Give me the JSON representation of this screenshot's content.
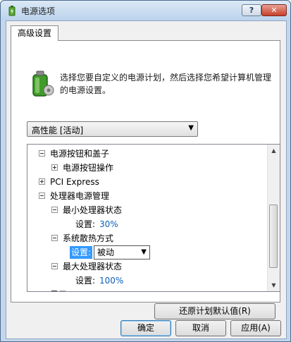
{
  "window": {
    "title": "电源选项",
    "help_label": "?",
    "close_label": "✕"
  },
  "tab": {
    "label": "高级设置"
  },
  "description": "选择您要自定义的电源计划，然后选择您希望计算机管理的电源设置。",
  "plan": {
    "selected": "高性能 [活动]"
  },
  "tree": {
    "items": [
      {
        "label": "电源按钮和盖子"
      },
      {
        "label": "电源按钮操作"
      },
      {
        "label": "PCI Express"
      },
      {
        "label": "处理器电源管理"
      },
      {
        "label": "最小处理器状态"
      },
      {
        "label": "设置:",
        "value": "30%"
      },
      {
        "label": "系统散热方式"
      },
      {
        "label": "设置:",
        "value": "被动"
      },
      {
        "label": "最大处理器状态"
      },
      {
        "label": "设置:",
        "value": "100%"
      },
      {
        "label": "显示"
      }
    ]
  },
  "buttons": {
    "restore": "还原计划默认值(R)",
    "ok": "确定",
    "cancel": "取消",
    "apply": "应用(A)"
  },
  "colors": {
    "setting_value": "#0d5fb8",
    "selection": "#3399ff"
  }
}
